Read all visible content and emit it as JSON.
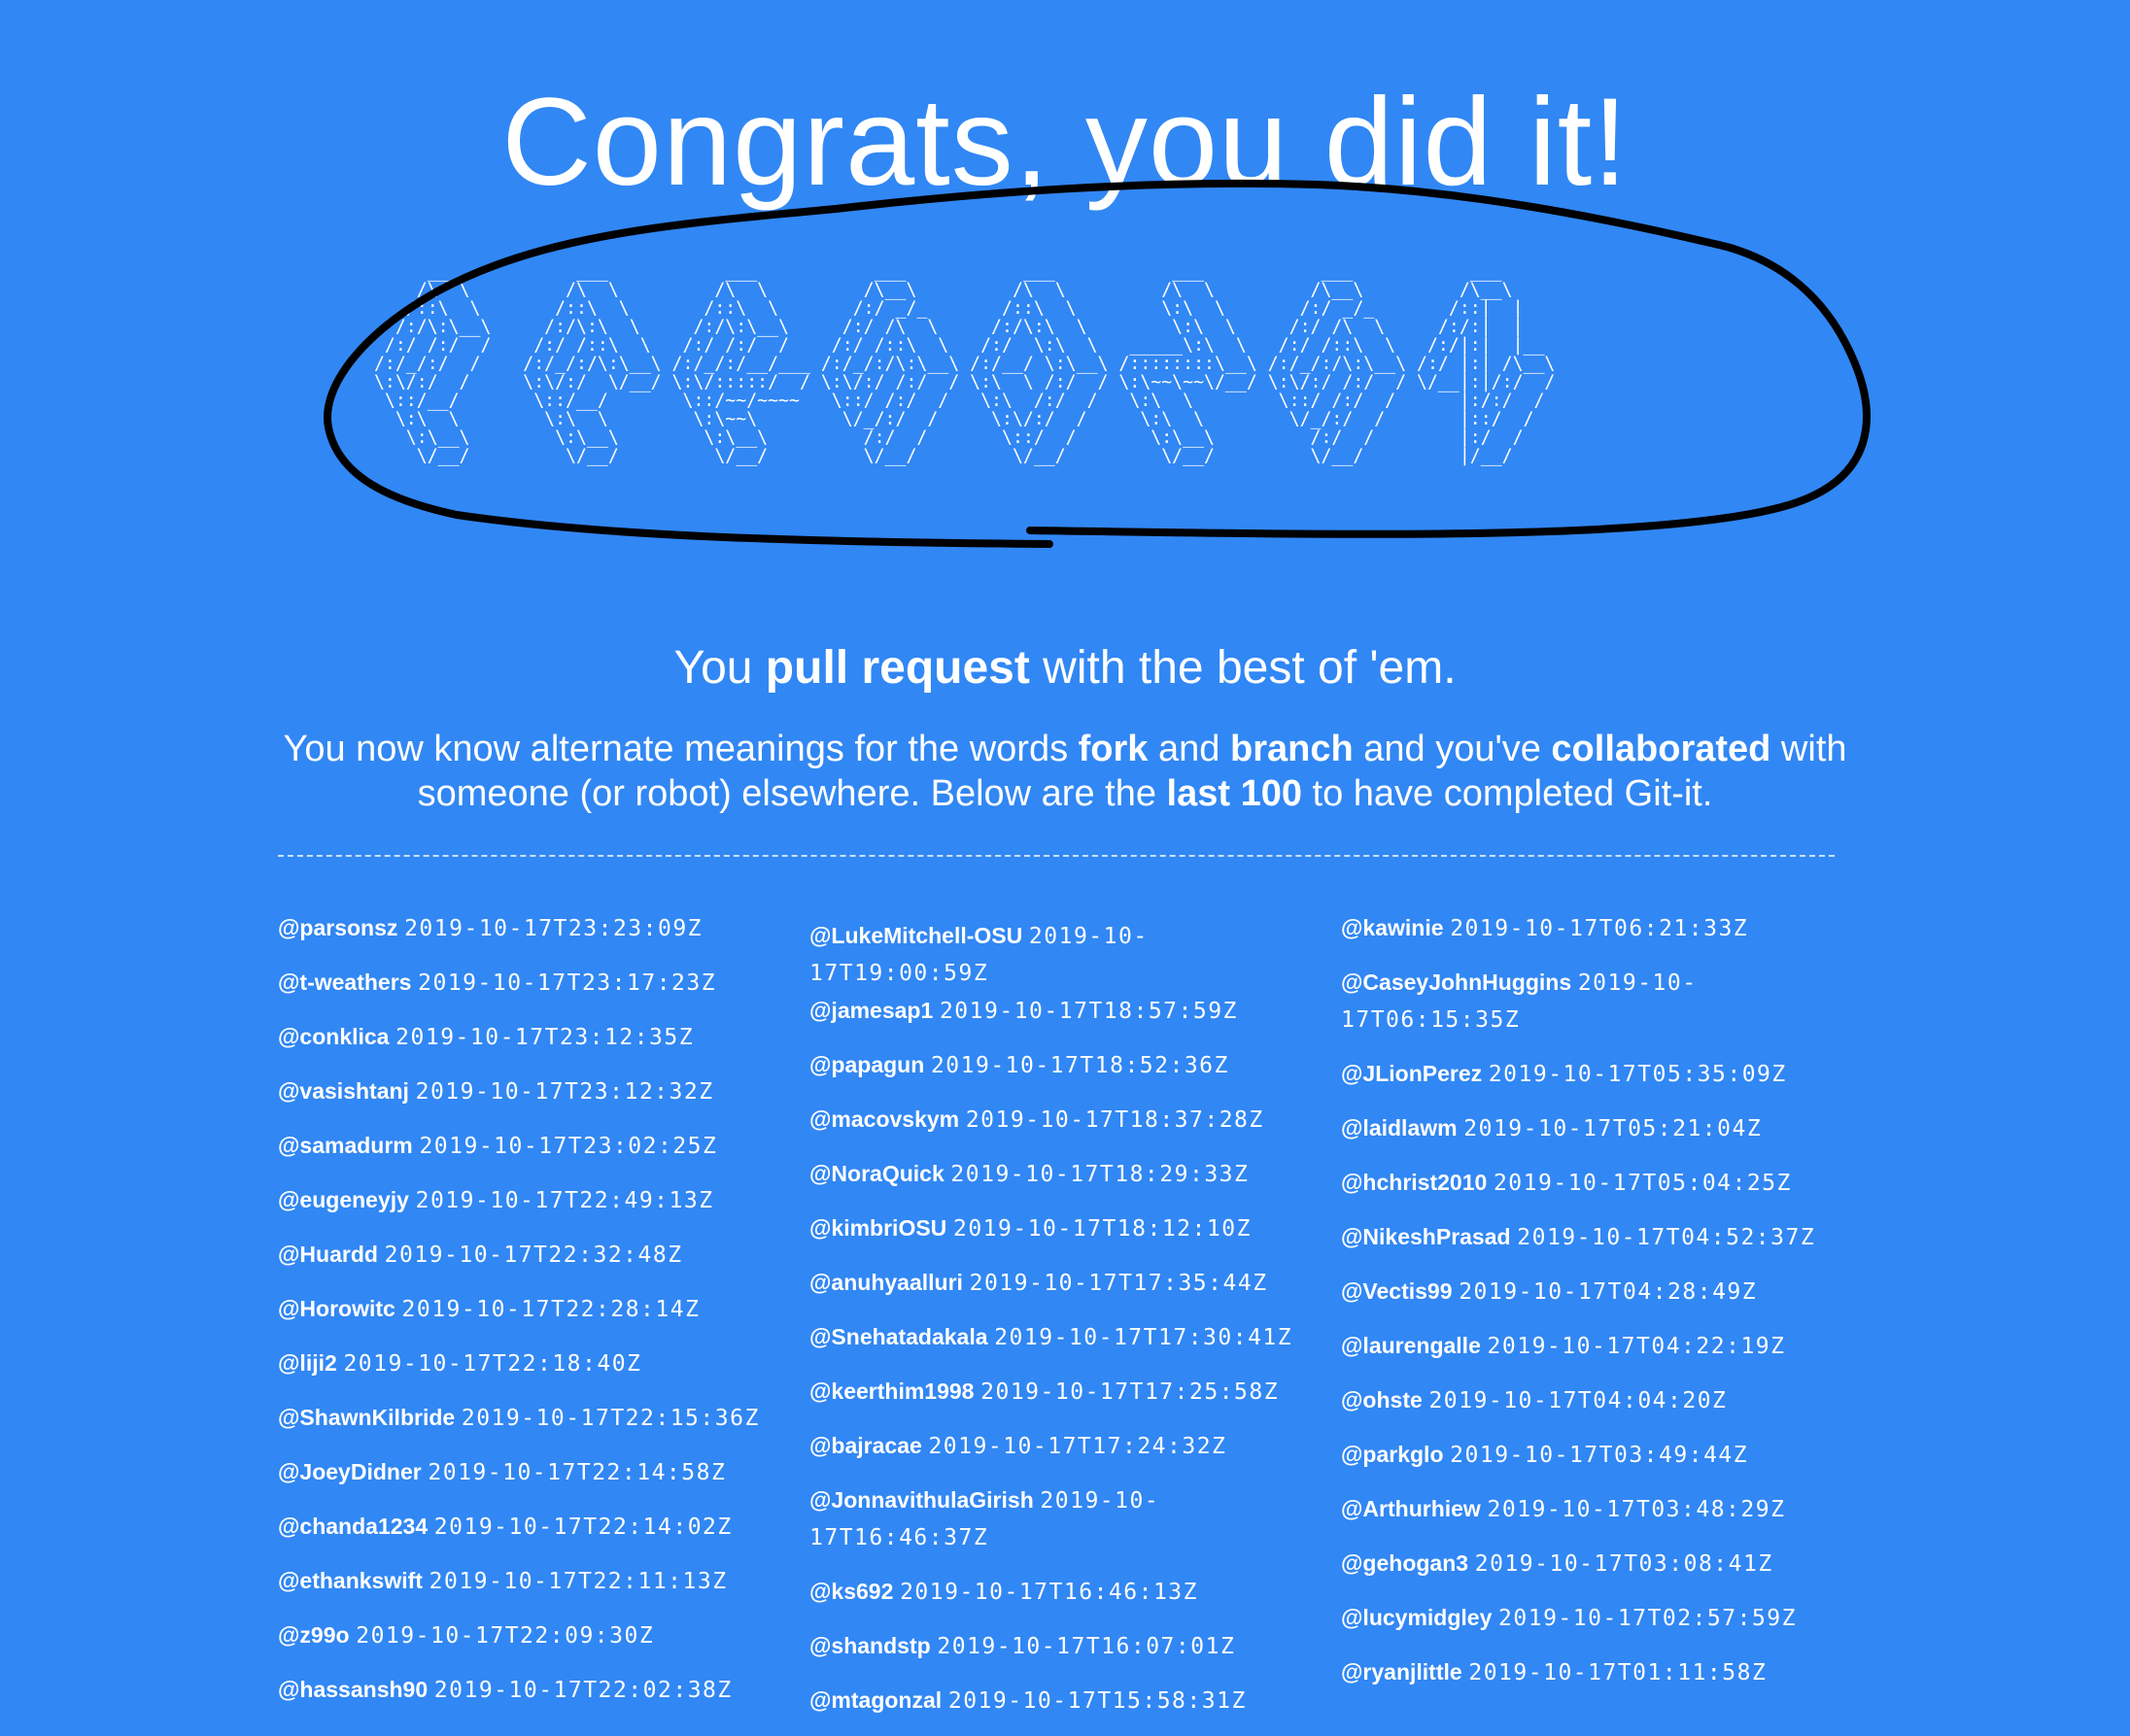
{
  "title": "Congrats, you did it!",
  "ascii_art": "      ___           ___           ___           ___           ___           ___           ___           ___     \n     /\\  \\         /\\  \\         /\\  \\         /\\__\\         /\\  \\         /\\  \\         /\\__\\         /\\__\\    \n    /::\\  \\       /::\\  \\       /::\\  \\       /:/ _/_       /::\\  \\        \\:\\  \\       /:/ _/_       /::|  |   \n   /:/\\:\\__\\     /:/\\:\\  \\     /:/\\:\\__\\     /:/ /\\  \\     /:/\\:\\  \\        \\:\\  \\     /:/ /\\  \\     /:/:|  |   \n  /:/ /:/  /    /:/ /::\\  \\   /:/ /:/  /    /:/ /::\\  \\   /:/  \\:\\  \\   _____\\:\\  \\   /:/ /::\\  \\   /:/|:|  |__ \n /:/_/:/  /    /:/_/:/\\:\\__\\ /:/_/:/__/___ /:/_/:/\\:\\__\\ /:/__/ \\:\\__\\ /::::::::\\__\\ /:/_/:/\\:\\__\\ /:/ |:| /\\__\\\n \\:\\/:/  /     \\:\\/:/  \\/__/ \\:\\/:::::/  / \\:\\/:/ /:/  / \\:\\  \\ /:/  / \\:\\~~\\~~\\/__/ \\:\\/:/ /:/  / \\/__|:|/:/  /\n  \\::/__/       \\::/__/       \\::/~~/~~~~   \\::/ /:/  /   \\:\\  /:/  /   \\:\\  \\        \\::/ /:/  /      |:/:/  / \n   \\:\\  \\        \\:\\  \\        \\:\\~~\\        \\/_/:/  /     \\:\\/:/  /     \\:\\  \\        \\/_/:/  /       |::/  /  \n    \\:\\__\\        \\:\\__\\        \\:\\__\\         /:/  /       \\::/  /       \\:\\__\\         /:/  /        |:/  /   \n     \\/__/         \\/__/         \\/__/         \\/__/         \\/__/         \\/__/         \\/__/         |/__/    ",
  "tagline": {
    "pre": "You ",
    "bold": "pull request",
    "post": " with the best of 'em."
  },
  "intro": {
    "t1": "You now know alternate meanings for the words ",
    "b1": "fork",
    "t2": " and ",
    "b2": "branch",
    "t3": " and you've ",
    "b3": "collaborated",
    "t4": " with someone (or robot) elsewhere. Below are the ",
    "b4": "last 100",
    "t5": " to have completed Git-it."
  },
  "columns": [
    [
      {
        "user": "@parsonsz",
        "time": "2019-10-17T23:23:09Z"
      },
      {
        "user": "@t-weathers",
        "time": "2019-10-17T23:17:23Z"
      },
      {
        "user": "@conklica",
        "time": "2019-10-17T23:12:35Z"
      },
      {
        "user": "@vasishtanj",
        "time": "2019-10-17T23:12:32Z"
      },
      {
        "user": "@samadurm",
        "time": "2019-10-17T23:02:25Z"
      },
      {
        "user": "@eugeneyjy",
        "time": "2019-10-17T22:49:13Z"
      },
      {
        "user": "@Huardd",
        "time": "2019-10-17T22:32:48Z"
      },
      {
        "user": "@Horowitc",
        "time": "2019-10-17T22:28:14Z"
      },
      {
        "user": "@liji2",
        "time": "2019-10-17T22:18:40Z"
      },
      {
        "user": "@ShawnKilbride",
        "time": "2019-10-17T22:15:36Z"
      },
      {
        "user": "@JoeyDidner",
        "time": "2019-10-17T22:14:58Z"
      },
      {
        "user": "@chanda1234",
        "time": "2019-10-17T22:14:02Z"
      },
      {
        "user": "@ethankswift",
        "time": "2019-10-17T22:11:13Z"
      },
      {
        "user": "@z99o",
        "time": "2019-10-17T22:09:30Z"
      },
      {
        "user": "@hassansh90",
        "time": "2019-10-17T22:02:38Z"
      }
    ],
    [
      {
        "user": "@LukeMitchell-OSU",
        "time": "2019-10-17T19:00:59Z"
      },
      {
        "user": "@jamesap1",
        "time": "2019-10-17T18:57:59Z"
      },
      {
        "user": "@papagun",
        "time": "2019-10-17T18:52:36Z"
      },
      {
        "user": "@macovskym",
        "time": "2019-10-17T18:37:28Z"
      },
      {
        "user": "@NoraQuick",
        "time": "2019-10-17T18:29:33Z"
      },
      {
        "user": "@kimbriOSU",
        "time": "2019-10-17T18:12:10Z"
      },
      {
        "user": "@anuhyaalluri",
        "time": "2019-10-17T17:35:44Z"
      },
      {
        "user": "@Snehatadakala",
        "time": "2019-10-17T17:30:41Z"
      },
      {
        "user": "@keerthim1998",
        "time": "2019-10-17T17:25:58Z"
      },
      {
        "user": "@bajracae",
        "time": "2019-10-17T17:24:32Z"
      },
      {
        "user": "@JonnavithulaGirish",
        "time": "2019-10-17T16:46:37Z"
      },
      {
        "user": "@ks692",
        "time": "2019-10-17T16:46:13Z"
      },
      {
        "user": "@shandstp",
        "time": "2019-10-17T16:07:01Z"
      },
      {
        "user": "@mtagonzal",
        "time": "2019-10-17T15:58:31Z"
      }
    ],
    [
      {
        "user": "@kawinie",
        "time": "2019-10-17T06:21:33Z"
      },
      {
        "user": "@CaseyJohnHuggins",
        "time": "2019-10-17T06:15:35Z"
      },
      {
        "user": "@JLionPerez",
        "time": "2019-10-17T05:35:09Z"
      },
      {
        "user": "@laidlawm",
        "time": "2019-10-17T05:21:04Z"
      },
      {
        "user": "@hchrist2010",
        "time": "2019-10-17T05:04:25Z"
      },
      {
        "user": "@NikeshPrasad",
        "time": "2019-10-17T04:52:37Z"
      },
      {
        "user": "@Vectis99",
        "time": "2019-10-17T04:28:49Z"
      },
      {
        "user": "@laurengalle",
        "time": "2019-10-17T04:22:19Z"
      },
      {
        "user": "@ohste",
        "time": "2019-10-17T04:04:20Z"
      },
      {
        "user": "@parkglo",
        "time": "2019-10-17T03:49:44Z"
      },
      {
        "user": "@Arthurhiew",
        "time": "2019-10-17T03:48:29Z"
      },
      {
        "user": "@gehogan3",
        "time": "2019-10-17T03:08:41Z"
      },
      {
        "user": "@lucymidgley",
        "time": "2019-10-17T02:57:59Z"
      },
      {
        "user": "@ryanjlittle",
        "time": "2019-10-17T01:11:58Z"
      }
    ]
  ]
}
